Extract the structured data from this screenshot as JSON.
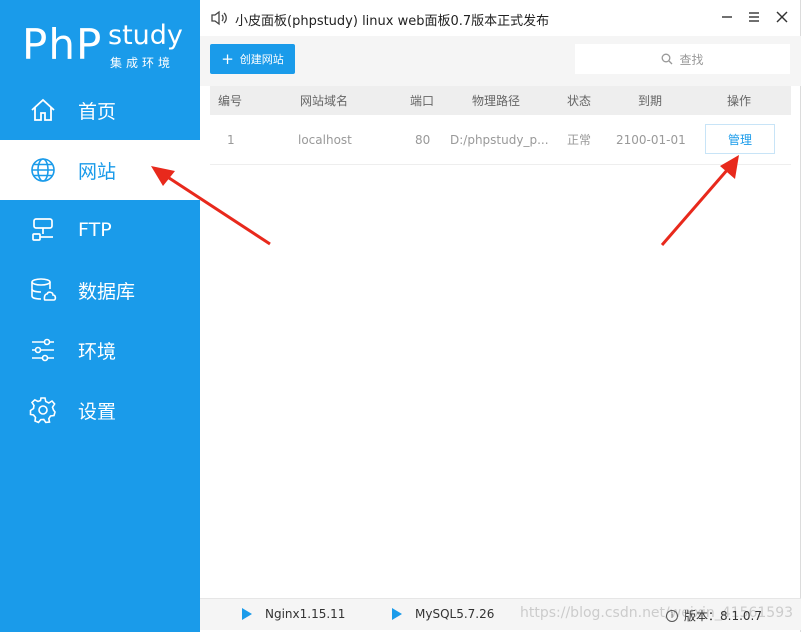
{
  "app": {
    "logo_main": "PhP",
    "logo_study": "study",
    "logo_sub": "集成环境",
    "window_title": "小皮面板(phpstudy) linux web面板0.7版本正式发布"
  },
  "sidebar": {
    "items": [
      {
        "label": "首页",
        "icon": "home-icon"
      },
      {
        "label": "网站",
        "icon": "globe-icon",
        "active": true
      },
      {
        "label": "FTP",
        "icon": "ftp-icon"
      },
      {
        "label": "数据库",
        "icon": "database-icon"
      },
      {
        "label": "环境",
        "icon": "sliders-icon"
      },
      {
        "label": "设置",
        "icon": "gear-icon"
      }
    ]
  },
  "toolbar": {
    "create_label": "创建网站",
    "search_placeholder": "查找"
  },
  "table": {
    "headers": [
      "编号",
      "网站域名",
      "端口",
      "物理路径",
      "状态",
      "到期",
      "操作"
    ],
    "rows": [
      {
        "num": "1",
        "domain": "localhost",
        "port": "80",
        "path": "D:/phpstudy_p...",
        "status": "正常",
        "expire": "2100-01-01",
        "action": "管理"
      }
    ]
  },
  "statusbar": {
    "nginx": "Nginx1.15.11",
    "mysql": "MySQL5.7.26",
    "version_label": "版本：",
    "version_value": "8.1.0.7",
    "watermark": "https://blog.csdn.net/weixin_41561593"
  },
  "colors": {
    "accent": "#1a9bea",
    "annotation_arrow": "#e8291c"
  }
}
